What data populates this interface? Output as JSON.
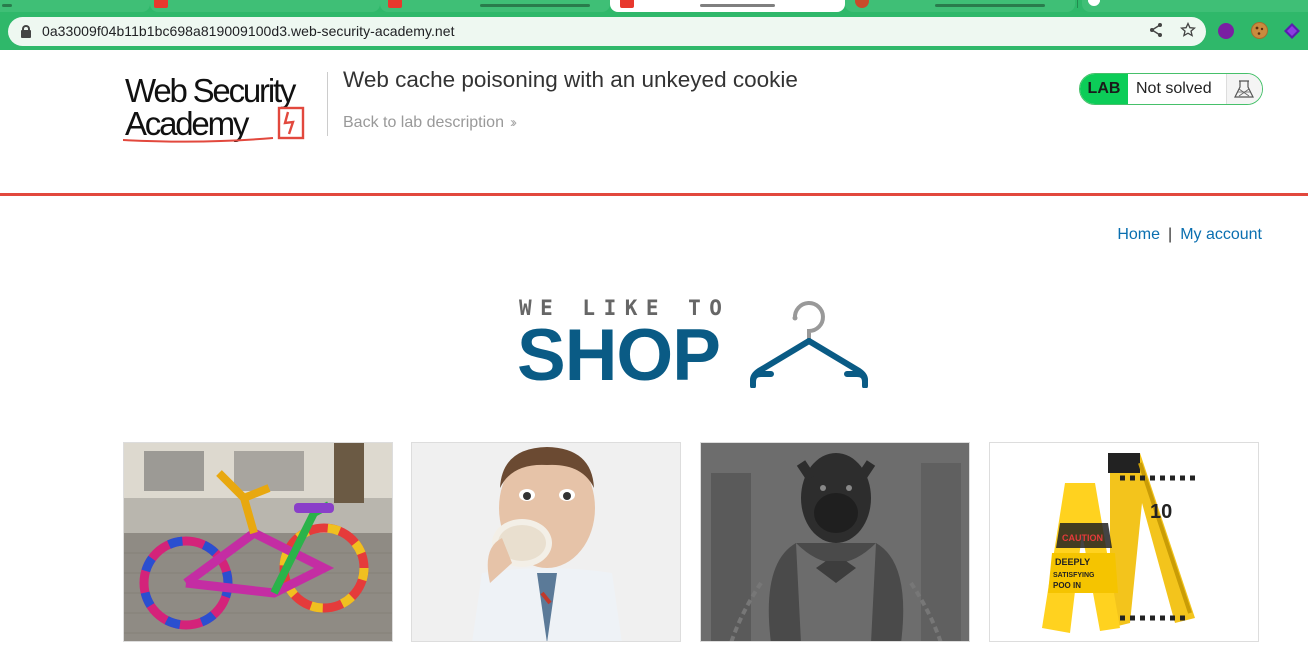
{
  "browser": {
    "url": "0a33009f04b11b1bc698a819009100d3.web-security-academy.net"
  },
  "header": {
    "logo_text": "Web Security Academy",
    "lab_title": "Web cache poisoning with an unkeyed cookie",
    "back_link": "Back to lab description",
    "lab_badge": "LAB",
    "lab_status": "Not solved"
  },
  "nav": {
    "home": "Home",
    "separator": "|",
    "my_account": "My account"
  },
  "banner": {
    "tagline": "WE LIKE TO",
    "title": "SHOP"
  },
  "products": [
    {
      "image": "yarn-bombed-bicycle"
    },
    {
      "image": "man-eating-donut"
    },
    {
      "image": "muscular-dog-superman"
    },
    {
      "image": "caution-wet-floor-signs"
    }
  ],
  "colors": {
    "browser_green": "#2fb86a",
    "header_rule": "#e2483d",
    "lab_green": "#0ccd58",
    "link_blue": "#0a6fb0",
    "shop_blue": "#0a5b85"
  }
}
